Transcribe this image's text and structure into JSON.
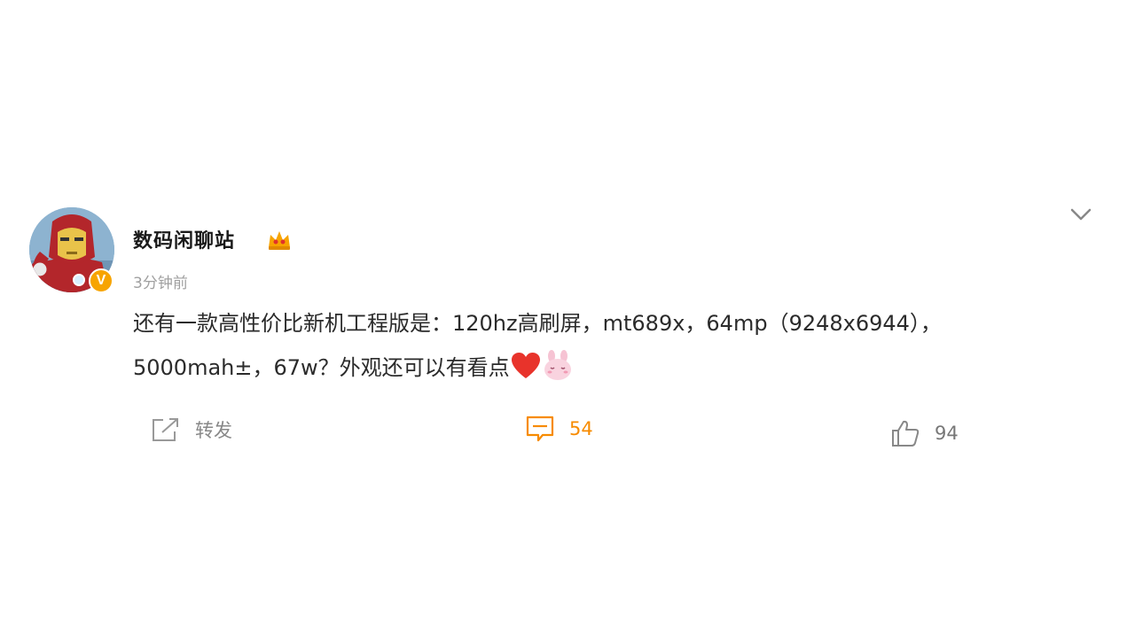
{
  "author": {
    "name": "数码闲聊站",
    "verified_badge": "V",
    "avatar_icon": "iron-man-avatar",
    "timestamp": "3分钟前"
  },
  "post": {
    "line1": "还有一款高性价比新机工程版是：120hz高刷屏，mt689x，64mp（9248x6944），",
    "line2": "5000mah±，67w？外观还可以有看点",
    "emojis": [
      "heart-emoji",
      "bunny-emoji"
    ]
  },
  "actions": {
    "repost_label": "转发",
    "comment_count": "54",
    "like_count": "94"
  },
  "colors": {
    "accent_orange": "#f78b00",
    "badge_gold": "#f7a400",
    "muted_gray": "#a0a0a0"
  }
}
